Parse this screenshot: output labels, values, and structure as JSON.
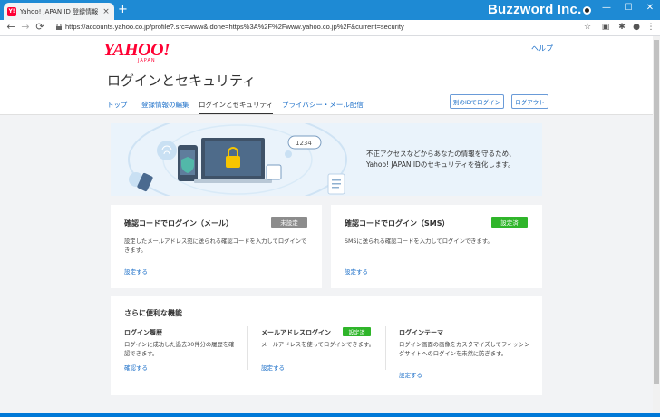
{
  "browser": {
    "tab_title": "Yahoo! JAPAN ID 登録情報 - Yah",
    "tab_favicon": "Y!",
    "tab_close": "×",
    "new_tab": "+",
    "watermark": "Buzzword Inc.",
    "window_buttons": [
      "—",
      "☐",
      "✕"
    ],
    "nav": [
      "←",
      "→",
      "⟳"
    ],
    "url": "https://accounts.yahoo.co.jp/profile?.src=www&.done=https%3A%2F%2Fwww.yahoo.co.jp%2F&current=security",
    "toolbar_icons": [
      "☆",
      "▣",
      "✱",
      "●",
      "⋮"
    ]
  },
  "header": {
    "logo": "YAHOO!",
    "logo_sub": "JAPAN",
    "help": "ヘルプ",
    "title": "ログインとセキュリティ",
    "tabs": [
      "トップ",
      "登録情報の編集",
      "ログインとセキュリティ",
      "プライバシー・メール配信"
    ],
    "active_tab_index": 2,
    "other_login_button": "別のIDでログイン",
    "logout_button": "ログアウト"
  },
  "hero": {
    "line1": "不正アクセスなどからあなたの情報を守るため、",
    "line2": "Yahoo! JAPAN IDのセキュリティを強化します。",
    "code_text": "1234"
  },
  "cards": {
    "email": {
      "title": "確認コードでログイン（メール）",
      "badge": "未設定",
      "desc": "設定したメールアドレス宛に送られる確認コードを入力してログインできます。",
      "link": "設定する"
    },
    "sms": {
      "title": "確認コードでログイン（SMS）",
      "badge": "設定済",
      "desc": "SMSに送られる確認コードを入力してログインできます。",
      "link": "設定する"
    }
  },
  "features": {
    "title": "さらに便利な機能",
    "items": [
      {
        "title": "ログイン履歴",
        "badge": "",
        "desc": "ログインに成功した過去30件分の履歴を確認できます。",
        "link": "確認する"
      },
      {
        "title": "メールアドレスログイン",
        "badge": "設定済",
        "desc": "メールアドレスを使ってログインできます。",
        "link": "設定する"
      },
      {
        "title": "ログインテーマ",
        "badge": "",
        "desc": "ログイン画面の画像をカスタマイズしてフィッシングサイトへのログインを未然に防ぎます。",
        "link": "設定する"
      }
    ]
  },
  "colors": {
    "accent_link": "#1a6ec8",
    "badge_set": "#2fb52a",
    "badge_unset": "#8c8c8c",
    "brand_red": "#ff0033"
  }
}
